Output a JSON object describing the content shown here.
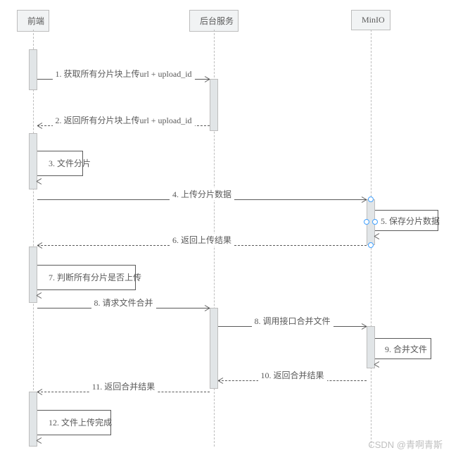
{
  "participants": {
    "frontend": "前端",
    "backend": "后台服务",
    "minio": "MinIO"
  },
  "messages": {
    "m1": "1. 获取所有分片块上传url + upload_id",
    "m2": "2. 返回所有分片块上传url + upload_id",
    "m3": "3. 文件分片",
    "m4": "4. 上传分片数据",
    "m5": "5. 保存分片数据",
    "m6": "6. 返回上传结果",
    "m7": "7. 判断所有分片是否上传",
    "m8a": "8. 请求文件合并",
    "m8b": "8. 调用接口合并文件",
    "m9": "9. 合并文件",
    "m10": "10. 返回合并结果",
    "m11": "11. 返回合并结果",
    "m12": "12. 文件上传完成"
  },
  "watermark": "CSDN @青啊青斯"
}
